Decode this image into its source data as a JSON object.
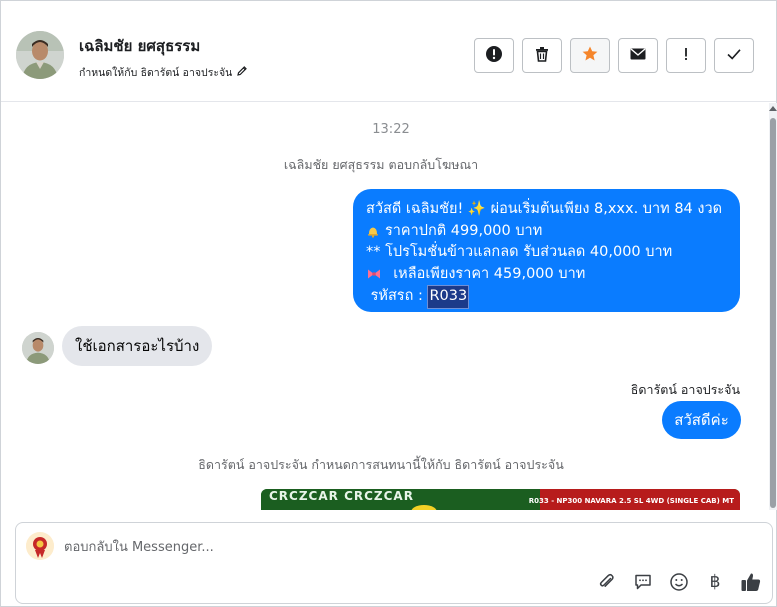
{
  "header": {
    "contact_name": "เฉลิมชัย ยศสุธรรม",
    "assigned_label": "กำหนดให้กับ ธิดารัตน์ อาจประจัน",
    "actions": [
      {
        "icon": "alert-circle-icon",
        "name": "spam-button"
      },
      {
        "icon": "trash-icon",
        "name": "delete-button"
      },
      {
        "icon": "star-icon",
        "name": "star-button"
      },
      {
        "icon": "envelope-icon",
        "name": "mark-unread-button"
      },
      {
        "icon": "exclamation-icon",
        "name": "follow-up-button"
      },
      {
        "icon": "check-icon",
        "name": "mark-done-button"
      }
    ],
    "star_color": "#f5852b"
  },
  "chat": {
    "time": "13:22",
    "system_reply_ad": "เฉลิมชัย ยศสุธรรม ตอบกลับโฆษณา",
    "outgoing_message": {
      "line1": "สวัสดี เฉลิมชัย! ✨  ผ่อนเริ่มต้นเพียง 8,xxx. บาท 84 งวด",
      "line2_icon": "bell-icon",
      "line2": "ราคาปกติ 499,000 บาท",
      "line3": "** โปรโมชั่นข้าวแลกลด รับส่วนลด 40,000 บาท",
      "line4_icon": "ribbon-icon",
      "line4": "  เหลือเพียงราคา 459,000 บาท",
      "line5_prefix": " รหัสรถ : ",
      "line5_code": "R033"
    },
    "incoming_message": "ใช้เอกสารอะไรบ้าง",
    "agent_name": "ธิดารัตน์ อาจประจัน",
    "agent_message": "สวัสดีค่ะ",
    "system_assign": "ธิดารัตน์ อาจประจัน กำหนดการสนทนานี้ให้กับ ธิดารัตน์ อาจประจัน",
    "promo_image": {
      "left_text": "CRCZCAR CRCZCAR",
      "right_text": "R033 - NP300 NAVARA 2.5 SL 4WD (SINGLE CAB) MT"
    },
    "bubble_color": "#0a7cff"
  },
  "composer": {
    "placeholder": "ตอบกลับใน Messenger...",
    "value": "",
    "tools": [
      "paperclip-icon",
      "saved-reply-icon",
      "emoji-icon",
      "baht-icon",
      "thumbs-up-icon"
    ],
    "baht_symbol": "฿"
  }
}
